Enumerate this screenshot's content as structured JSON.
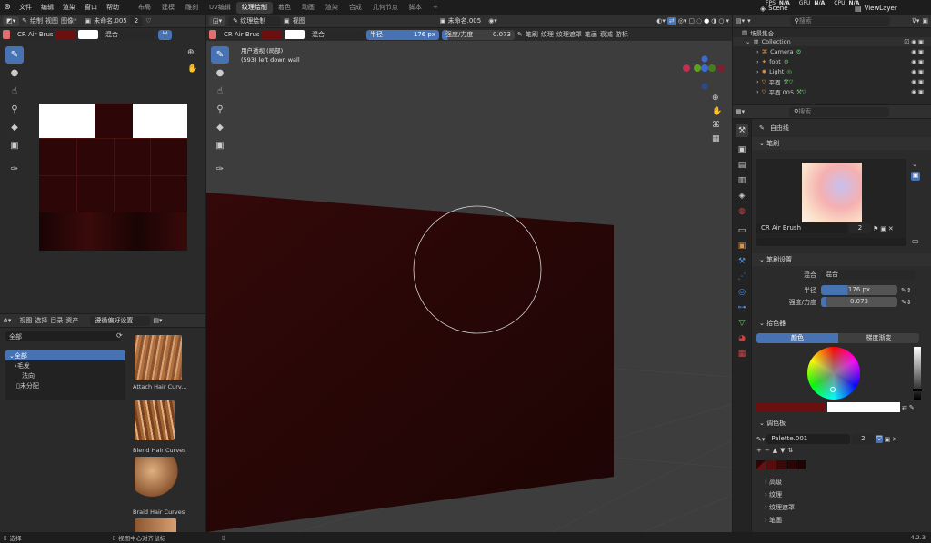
{
  "menu": [
    "文件",
    "编辑",
    "渲染",
    "窗口",
    "帮助"
  ],
  "workspaces": [
    "布局",
    "建模",
    "雕刻",
    "UV编辑",
    "纹理绘制",
    "着色",
    "动画",
    "渲染",
    "合成",
    "几何节点",
    "脚本"
  ],
  "active_workspace": "纹理绘制",
  "plus": "+",
  "stats": {
    "fps_label": "FPS",
    "fps": "N/A",
    "gpu_label": "GPU",
    "gpu": "N/A",
    "cpu_label": "CPU",
    "cpu": "N/A"
  },
  "scene": "Scene",
  "view_layer": "ViewLayer",
  "image_editor": {
    "header_items": [
      "绘制",
      "视图",
      "图像*"
    ],
    "image_name": "未命名.005",
    "image_users": "2",
    "brush_name": "CR Air Brush",
    "blend": "混合",
    "radius_btn": "半"
  },
  "viewport": {
    "mode": "纹理绘制",
    "view_menu": "视图",
    "image_name": "未命名.005",
    "brush_name": "CR Air Brush",
    "blend": "混合",
    "radius_label": "半径",
    "radius_value": "176 px",
    "strength_label": "强度/力度",
    "strength_value": "0.073",
    "header_tabs": [
      "笔刷",
      "纹理",
      "纹理遮罩",
      "笔画",
      "衰减",
      "游标"
    ],
    "overlay_title": "用户透视 (局部)",
    "overlay_sub": "(593) left down wall"
  },
  "asset_browser": {
    "header_items": [
      "视图",
      "选择",
      "目录",
      "资产"
    ],
    "library": "遵循偏好设置",
    "filter": "全部",
    "tree": [
      "全部",
      "毛发",
      "法向",
      "未分配"
    ],
    "assets": [
      "Attach Hair Curv...",
      "Blend Hair Curves",
      "Braid Hair Curves"
    ]
  },
  "outliner": {
    "search_placeholder": "搜索",
    "root": "场景集合",
    "items": [
      "Collection",
      "Camera",
      "foot",
      "Light",
      "平面",
      "平面.005"
    ]
  },
  "properties": {
    "search_placeholder": "搜索",
    "tool_name": "自由线",
    "brush_section": "笔刷",
    "brush_name": "CR Air Brush",
    "brush_users": "2",
    "brush_settings": "笔刷设置",
    "blend_label": "混合",
    "blend_value": "混合",
    "radius_label": "半径",
    "radius_value": "176 px",
    "strength_label": "强度/力度",
    "strength_value": "0.073",
    "color_picker": "拾色器",
    "color_tab": "颜色",
    "gradient_tab": "梯度渐变",
    "palette_section": "调色板",
    "palette_name": "Palette.001",
    "palette_users": "2",
    "collapsed": [
      "高级",
      "纹理",
      "纹理遮罩",
      "笔画"
    ]
  },
  "status": {
    "left": "选择",
    "middle": "视图中心对齐鼠标",
    "version": "4.2.3"
  },
  "colors": {
    "primary_brush": "#6b1010",
    "secondary_brush": "#ffffff",
    "accent": "#4772b3",
    "texture_dark": "#2d0707"
  }
}
